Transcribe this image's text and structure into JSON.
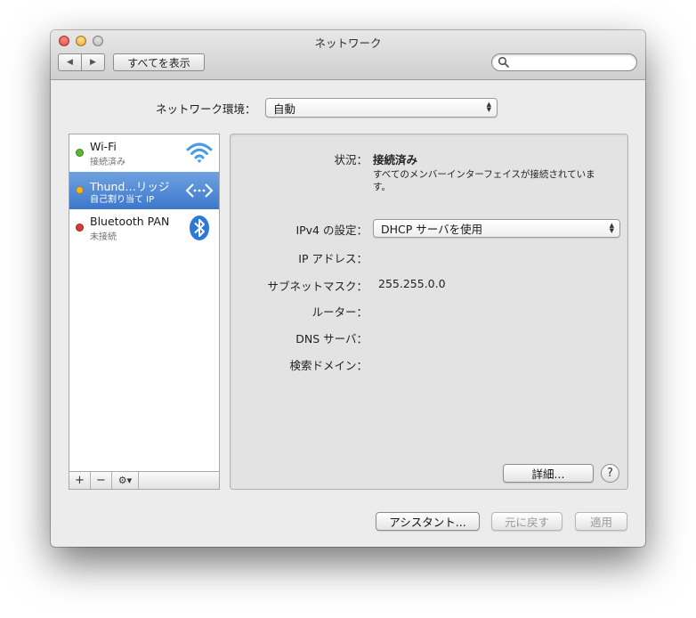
{
  "window": {
    "title": "ネットワーク",
    "nav_back": "◀",
    "nav_forward": "▶",
    "show_all_label": "すべてを表示",
    "search_placeholder": ""
  },
  "location": {
    "label": "ネットワーク環境：",
    "selected": "自動"
  },
  "services": [
    {
      "name": "Wi-Fi",
      "status": "接続済み",
      "dot_color": "#5cb82e",
      "icon": "wifi-icon"
    },
    {
      "name": "Thund…リッジ",
      "status": "自己割り当て IP",
      "dot_color": "#f0b429",
      "icon": "thunderbolt-bridge-icon",
      "selected": true
    },
    {
      "name": "Bluetooth PAN",
      "status": "未接続",
      "dot_color": "#d83a34",
      "icon": "bluetooth-icon"
    }
  ],
  "sidebar_toolbar": {
    "add": "+",
    "remove": "−",
    "gear": "⚙▾"
  },
  "detail": {
    "status_label": "状況：",
    "status_value": "接続済み",
    "status_desc": "すべてのメンバーインターフェイスが接続されています。",
    "ipv4_label": "IPv4 の設定：",
    "ipv4_value": "DHCP サーバを使用",
    "ip_label": "IP アドレス：",
    "subnet_label": "サブネットマスク：",
    "subnet_value": "255.255.0.0",
    "router_label": "ルーター：",
    "dns_label": "DNS サーバ：",
    "search_domain_label": "検索ドメイン：",
    "advanced_label": "詳細...",
    "help_label": "?"
  },
  "footer": {
    "assistant_label": "アシスタント...",
    "revert_label": "元に戻す",
    "apply_label": "適用"
  }
}
